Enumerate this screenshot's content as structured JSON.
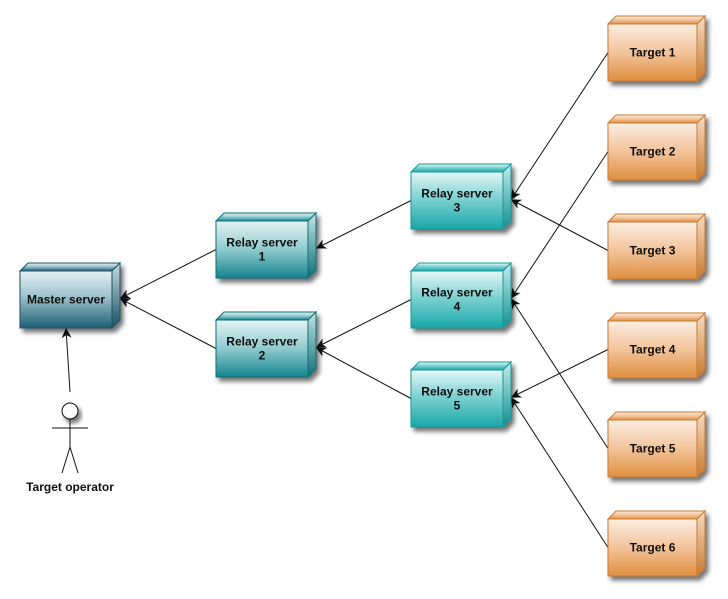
{
  "diagram": {
    "type": "deployment",
    "colors": {
      "master": "#1f6a80",
      "relay_dark": "#1a8a95",
      "relay_bright": "#22b0b0",
      "target": "#e5994d",
      "edge": "#111111"
    },
    "nodes": [
      {
        "id": "master",
        "kind": "master",
        "lines": [
          "Master server"
        ]
      },
      {
        "id": "relay1",
        "kind": "relay_dark",
        "lines": [
          "Relay server",
          "1"
        ]
      },
      {
        "id": "relay2",
        "kind": "relay_dark",
        "lines": [
          "Relay server",
          "2"
        ]
      },
      {
        "id": "relay3",
        "kind": "relay_bright",
        "lines": [
          "Relay server",
          "3"
        ]
      },
      {
        "id": "relay4",
        "kind": "relay_bright",
        "lines": [
          "Relay server",
          "4"
        ]
      },
      {
        "id": "relay5",
        "kind": "relay_bright",
        "lines": [
          "Relay server",
          "5"
        ]
      },
      {
        "id": "target1",
        "kind": "target",
        "lines": [
          "Target 1"
        ]
      },
      {
        "id": "target2",
        "kind": "target",
        "lines": [
          "Target 2"
        ]
      },
      {
        "id": "target3",
        "kind": "target",
        "lines": [
          "Target 3"
        ]
      },
      {
        "id": "target4",
        "kind": "target",
        "lines": [
          "Target 4"
        ]
      },
      {
        "id": "target5",
        "kind": "target",
        "lines": [
          "Target 5"
        ]
      },
      {
        "id": "target6",
        "kind": "target",
        "lines": [
          "Target 6"
        ]
      }
    ],
    "actor": {
      "id": "operator",
      "label": "Target operator"
    },
    "edges": [
      {
        "from": "relay1",
        "to": "master"
      },
      {
        "from": "relay2",
        "to": "master"
      },
      {
        "from": "relay3",
        "to": "relay1"
      },
      {
        "from": "relay4",
        "to": "relay2"
      },
      {
        "from": "relay5",
        "to": "relay2"
      },
      {
        "from": "target1",
        "to": "relay3"
      },
      {
        "from": "target3",
        "to": "relay3"
      },
      {
        "from": "target2",
        "to": "relay4"
      },
      {
        "from": "target5",
        "to": "relay4"
      },
      {
        "from": "target4",
        "to": "relay5"
      },
      {
        "from": "target6",
        "to": "relay5"
      },
      {
        "from": "operator",
        "to": "master"
      }
    ]
  }
}
